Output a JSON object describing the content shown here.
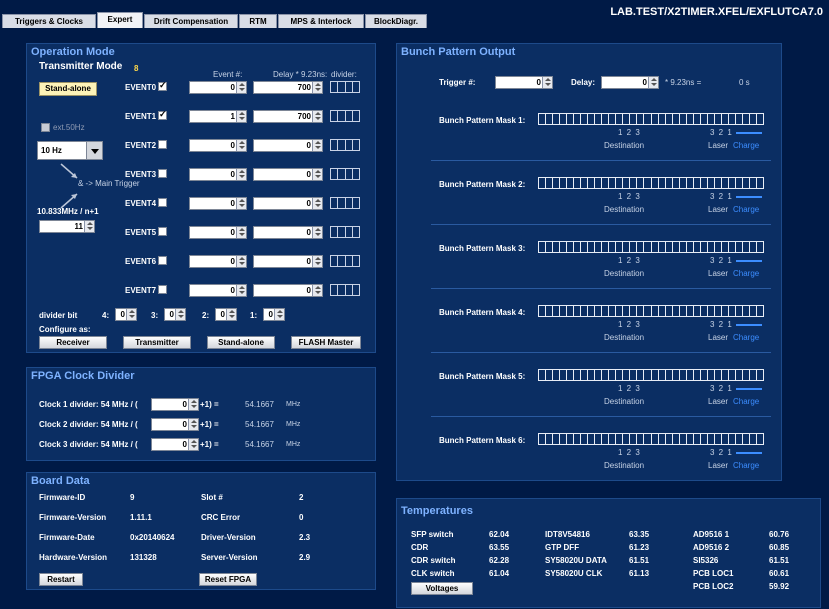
{
  "tabs": [
    {
      "label": "Triggers & Clocks"
    },
    {
      "label": "Expert"
    },
    {
      "label": "Drift Compensation"
    },
    {
      "label": "RTM"
    },
    {
      "label": "MPS & Interlock"
    },
    {
      "label": "BlockDiagr."
    }
  ],
  "window_title": "LAB.TEST/X2TIMER.XFEL/EXFLUTCA7.0",
  "op": {
    "title": "Operation Mode",
    "tx_mode_label": "Transmitter Mode",
    "tx_mode_value": "8",
    "standalone_btn": "Stand-alone",
    "ext50_label": "ext.50Hz",
    "freq_select": "10 Hz",
    "main_trigger": "& -> Main Trigger",
    "freq_formula": "10.833MHz / n+1",
    "n_value": "11",
    "col_event": "Event #:",
    "col_delay": "Delay * 9.23ns:",
    "col_divider": "divider:",
    "events": [
      {
        "label": "EVENT0",
        "checked": true,
        "event": "0",
        "delay": "700"
      },
      {
        "label": "EVENT1",
        "checked": true,
        "event": "1",
        "delay": "700"
      },
      {
        "label": "EVENT2",
        "checked": false,
        "event": "0",
        "delay": "0"
      },
      {
        "label": "EVENT3",
        "checked": false,
        "event": "0",
        "delay": "0"
      },
      {
        "label": "EVENT4",
        "checked": false,
        "event": "0",
        "delay": "0"
      },
      {
        "label": "EVENT5",
        "checked": false,
        "event": "0",
        "delay": "0"
      },
      {
        "label": "EVENT6",
        "checked": false,
        "event": "0",
        "delay": "0"
      },
      {
        "label": "EVENT7",
        "checked": false,
        "event": "0",
        "delay": "0"
      }
    ],
    "divider_bit_label": "divider bit",
    "div_bits": [
      {
        "label": "4:",
        "value": "0"
      },
      {
        "label": "3:",
        "value": "0"
      },
      {
        "label": "2:",
        "value": "0"
      },
      {
        "label": "1:",
        "value": "0"
      }
    ],
    "configure_label": "Configure as:",
    "cfg_buttons": [
      "Receiver",
      "Transmitter",
      "Stand-alone",
      "FLASH Master"
    ]
  },
  "fpga": {
    "title": "FPGA Clock Divider",
    "rows": [
      {
        "label": "Clock 1 divider:  54 MHz / (",
        "value": "0",
        "suffix": "+1) =",
        "result": "54.1667",
        "unit": "MHz"
      },
      {
        "label": "Clock 2 divider:  54 MHz / (",
        "value": "0",
        "suffix": "+1) =",
        "result": "54.1667",
        "unit": "MHz"
      },
      {
        "label": "Clock 3 divider:  54 MHz / (",
        "value": "0",
        "suffix": "+1) =",
        "result": "54.1667",
        "unit": "MHz"
      }
    ]
  },
  "board": {
    "title": "Board Data",
    "left": [
      {
        "k": "Firmware-ID",
        "v": "9"
      },
      {
        "k": "Firmware-Version",
        "v": "1.11.1"
      },
      {
        "k": "Firmware-Date",
        "v": "0x20140624"
      },
      {
        "k": "Hardware-Version",
        "v": "131328"
      }
    ],
    "right": [
      {
        "k": "Slot #",
        "v": "2"
      },
      {
        "k": "CRC  Error",
        "v": "0"
      },
      {
        "k": "Driver-Version",
        "v": "2.3"
      },
      {
        "k": "Server-Version",
        "v": "2.9"
      }
    ],
    "restart_btn": "Restart",
    "reset_btn": "Reset FPGA"
  },
  "bunch": {
    "title": "Bunch Pattern Output",
    "trigger_label": "Trigger #:",
    "trigger_value": "0",
    "delay_label": "Delay:",
    "delay_value": "0",
    "delay_unit": "* 9.23ns  =",
    "delay_result": "0 s",
    "masks": [
      {
        "label": "Bunch Pattern Mask 1:"
      },
      {
        "label": "Bunch Pattern Mask 2:"
      },
      {
        "label": "Bunch Pattern Mask 3:"
      },
      {
        "label": "Bunch Pattern Mask 4:"
      },
      {
        "label": "Bunch Pattern Mask 5:"
      },
      {
        "label": "Bunch Pattern Mask 6:"
      }
    ],
    "dest_nums": "1 2 3",
    "laser_nums": "3 2 1",
    "destination": "Destination",
    "laser": "Laser",
    "charge": "Charge"
  },
  "temps": {
    "title": "Temperatures",
    "c1": [
      {
        "k": "SFP switch",
        "v": "62.04"
      },
      {
        "k": "CDR",
        "v": "63.55"
      },
      {
        "k": "CDR switch",
        "v": "62.28"
      },
      {
        "k": "CLK switch",
        "v": "61.04"
      }
    ],
    "c2": [
      {
        "k": "IDT8V54816",
        "v": "63.35"
      },
      {
        "k": "GTP DFF",
        "v": "61.23"
      },
      {
        "k": "SY58020U DATA",
        "v": "61.51"
      },
      {
        "k": "SY58020U CLK",
        "v": "61.13"
      }
    ],
    "c3": [
      {
        "k": "AD9516 1",
        "v": "60.76"
      },
      {
        "k": "AD9516 2",
        "v": "60.85"
      },
      {
        "k": "SI5326",
        "v": "61.51"
      },
      {
        "k": "PCB LOC1",
        "v": "60.61"
      },
      {
        "k": "PCB LOC2",
        "v": "59.92"
      }
    ],
    "voltages_btn": "Voltages"
  },
  "colors": {
    "background": "#001a46",
    "panel": "#0b2e63",
    "title": "#7eb2ff",
    "charge": "#3c8dff"
  }
}
